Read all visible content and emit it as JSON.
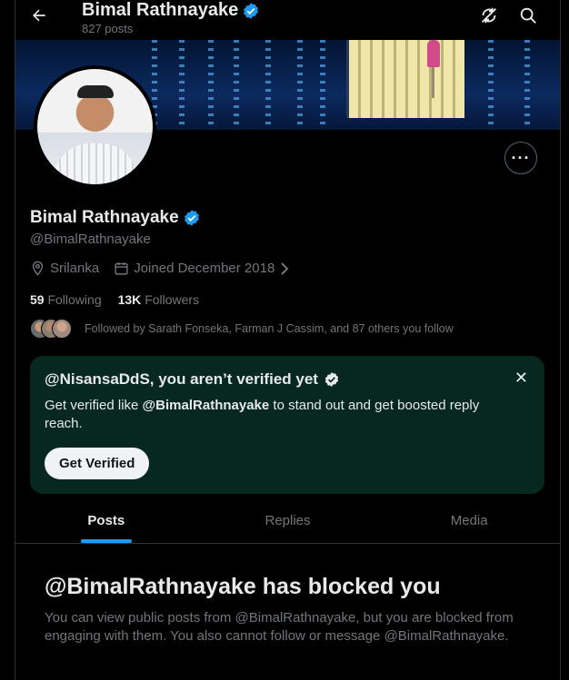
{
  "header": {
    "name": "Bimal Rathnayake",
    "posts_count": "827 posts"
  },
  "profile": {
    "name": "Bimal Rathnayake",
    "handle": "@BimalRathnayake",
    "location": "Srilanka",
    "joined": "Joined December 2018",
    "following_count": "59",
    "following_label": "Following",
    "followers_count": "13K",
    "followers_label": "Followers",
    "followed_by": "Followed by Sarath Fonseka, Farman J Cassim, and 87 others you follow"
  },
  "verify_card": {
    "title": "@NisansaDdS, you aren’t verified yet",
    "body_prefix": "Get verified like ",
    "body_handle": "@BimalRathnayake",
    "body_suffix": " to stand out and get boosted reply reach.",
    "button": "Get Verified",
    "close": "✕"
  },
  "tabs": [
    {
      "label": "Posts",
      "active": true
    },
    {
      "label": "Replies",
      "active": false
    },
    {
      "label": "Media",
      "active": false
    }
  ],
  "blocked": {
    "title": "@BimalRathnayake has blocked you",
    "message": "You can view public posts from @BimalRathnayake, but you are blocked from engaging with them. You also cannot follow or message @BimalRathnayake."
  },
  "icons": {
    "back": "arrow-left-icon",
    "verified": "verified-badge-icon",
    "refresh": "refresh-off-icon",
    "search": "search-icon",
    "more": "more-icon",
    "location": "location-pin-icon",
    "calendar": "calendar-icon",
    "chevron": "chevron-right-icon"
  },
  "colors": {
    "background": "#000000",
    "accent": "#1d9bf0",
    "card_background": "#07281f",
    "muted_text": "#71767b"
  }
}
